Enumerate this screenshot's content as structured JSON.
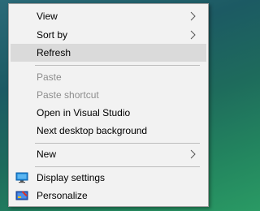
{
  "context_menu": {
    "items": [
      {
        "label": "View",
        "submenu_icon": "chevron-right-icon"
      },
      {
        "label": "Sort by",
        "submenu_icon": "chevron-right-icon"
      },
      {
        "label": "Refresh",
        "state": "highlighted"
      },
      {
        "label": "Paste",
        "state": "disabled"
      },
      {
        "label": "Paste shortcut",
        "state": "disabled"
      },
      {
        "label": "Open in Visual Studio"
      },
      {
        "label": "Next desktop background"
      },
      {
        "label": "New",
        "submenu_icon": "chevron-right-icon"
      },
      {
        "label": "Display settings",
        "icon": "display-icon"
      },
      {
        "label": "Personalize",
        "icon": "personalize-icon"
      }
    ]
  },
  "colors": {
    "menu_bg": "#f2f2f2",
    "highlight_bg": "#dadada",
    "disabled_text": "#8d8d8d",
    "desktop_bg": "#1e6b5c"
  }
}
